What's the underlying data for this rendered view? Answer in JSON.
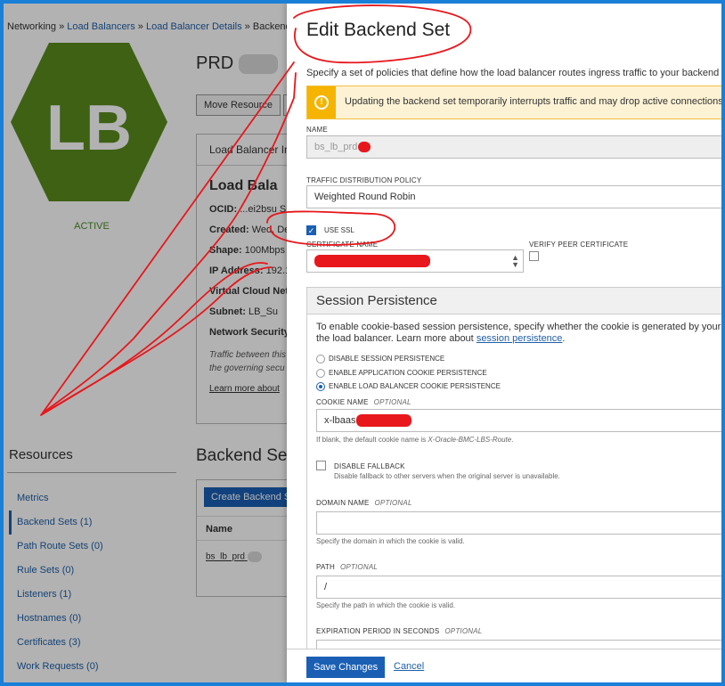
{
  "breadcrumb": {
    "networking": "Networking",
    "sep": "»",
    "load_balancers": "Load Balancers",
    "details": "Load Balancer Details",
    "current": "Backend S"
  },
  "lb": {
    "icon_text": "LB",
    "status": "ACTIVE",
    "title": "PRD"
  },
  "actions": {
    "move_resource": "Move Resource"
  },
  "info": {
    "header": "Load Balancer In",
    "big_title": "Load Bala",
    "rows": [
      {
        "key": "OCID:",
        "value": "...ei2bsu  S"
      },
      {
        "key": "Created:",
        "value": "Wed, De"
      },
      {
        "key": "Shape:",
        "value": "100Mbps"
      },
      {
        "key": "IP Address:",
        "value": "192.1"
      },
      {
        "key": "Virtual Cloud Netw",
        "value": ""
      },
      {
        "key": "Subnet:",
        "value": "LB_Su"
      },
      {
        "key": "Network Security",
        "value": ""
      }
    ],
    "traffic_note_1": "Traffic between this",
    "traffic_note_2": "the governing secu",
    "learn_more": "Learn more about"
  },
  "resources": {
    "title": "Resources",
    "items": [
      {
        "label": "Metrics"
      },
      {
        "label": "Backend Sets (1)"
      },
      {
        "label": "Path Route Sets (0)"
      },
      {
        "label": "Rule Sets (0)"
      },
      {
        "label": "Listeners (1)"
      },
      {
        "label": "Hostnames (0)"
      },
      {
        "label": "Certificates (3)"
      },
      {
        "label": "Work Requests (0)"
      }
    ]
  },
  "backend_sets": {
    "title": "Backend Se",
    "create_button": "Create Backend S",
    "col_name": "Name",
    "row_name": "bs_lb_prd"
  },
  "panel": {
    "title": "Edit Backend Set",
    "description": "Specify a set of policies that define how the load balancer routes ingress traffic to your backend serv",
    "warning": "Updating the backend set temporarily interrupts traffic and may drop active connections.",
    "name_label": "NAME",
    "name_value": "bs_lb_prd",
    "policy_label": "TRAFFIC DISTRIBUTION POLICY",
    "policy_value": "Weighted Round Robin",
    "use_ssl_label": "USE SSL",
    "cert_label": "CERTIFICATE NAME",
    "verify_label": "VERIFY PEER CERTIFICATE"
  },
  "session": {
    "title": "Session Persistence",
    "desc_1": "To enable cookie-based session persistence, specify whether the cookie is generated by your app",
    "desc_2": "the load balancer. Learn more about",
    "desc_link": "session persistence",
    "desc_end": ".",
    "options": [
      {
        "label": "DISABLE SESSION PERSISTENCE"
      },
      {
        "label": "ENABLE APPLICATION COOKIE PERSISTENCE"
      },
      {
        "label": "ENABLE LOAD BALANCER COOKIE PERSISTENCE"
      }
    ],
    "cookie_label": "COOKIE NAME",
    "optional": "OPTIONAL",
    "cookie_value": "x-lbaas",
    "cookie_help": "If blank, the default cookie name is",
    "cookie_default": "X-Oracle-BMC-LBS-Route",
    "cookie_help_end": ".",
    "fallback_label": "DISABLE FALLBACK",
    "fallback_help": "Disable fallback to other servers when the original server is unavailable.",
    "domain_label": "DOMAIN NAME",
    "domain_help": "Specify the domain in which the cookie is valid.",
    "path_label": "PATH",
    "path_value": "/",
    "path_help": "Specify the path in which the cookie is valid.",
    "expiration_label": "EXPIRATION PERIOD IN SECONDS"
  },
  "footer": {
    "save": "Save Changes",
    "cancel": "Cancel"
  },
  "colors": {
    "accent": "#1a5fb4",
    "lb_green": "#5a8c1e",
    "warning": "#f5b400",
    "annotation_red": "#e8171c",
    "frame_blue": "#1a7fd6"
  }
}
